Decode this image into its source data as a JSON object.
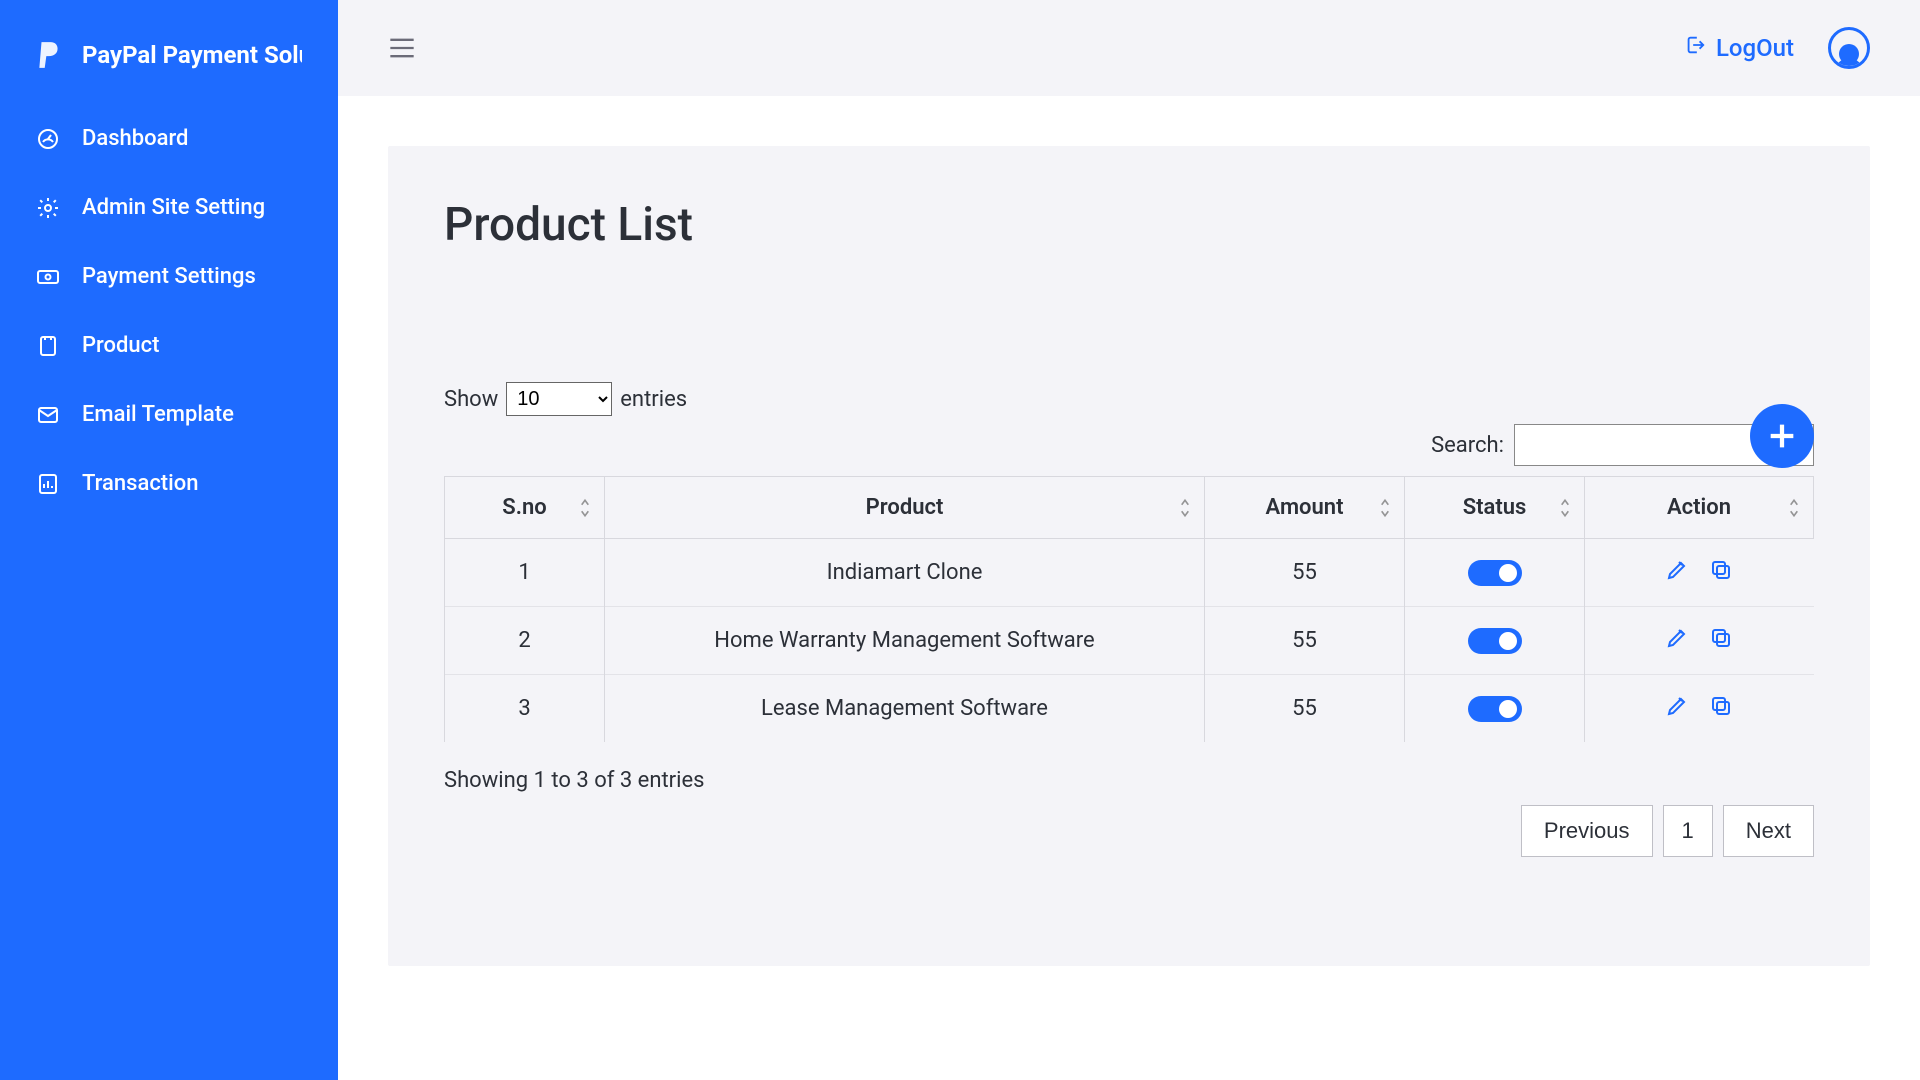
{
  "brand": {
    "title": "PayPal Payment Solu"
  },
  "sidebar": {
    "items": [
      {
        "label": "Dashboard"
      },
      {
        "label": "Admin Site Setting"
      },
      {
        "label": "Payment Settings"
      },
      {
        "label": "Product"
      },
      {
        "label": "Email Template"
      },
      {
        "label": "Transaction"
      }
    ]
  },
  "header": {
    "logout": "LogOut"
  },
  "page": {
    "title": "Product List",
    "show_label_pre": "Show",
    "show_label_post": "entries",
    "show_value": "10",
    "search_label": "Search:",
    "info": "Showing 1 to 3 of 3 entries",
    "prev": "Previous",
    "next": "Next",
    "page_num": "1"
  },
  "table": {
    "headers": {
      "sno": "S.no",
      "product": "Product",
      "amount": "Amount",
      "status": "Status",
      "action": "Action"
    },
    "rows": [
      {
        "sno": "1",
        "product": "Indiamart Clone",
        "amount": "55"
      },
      {
        "sno": "2",
        "product": "Home Warranty Management Software",
        "amount": "55"
      },
      {
        "sno": "3",
        "product": "Lease Management Software",
        "amount": "55"
      }
    ]
  }
}
